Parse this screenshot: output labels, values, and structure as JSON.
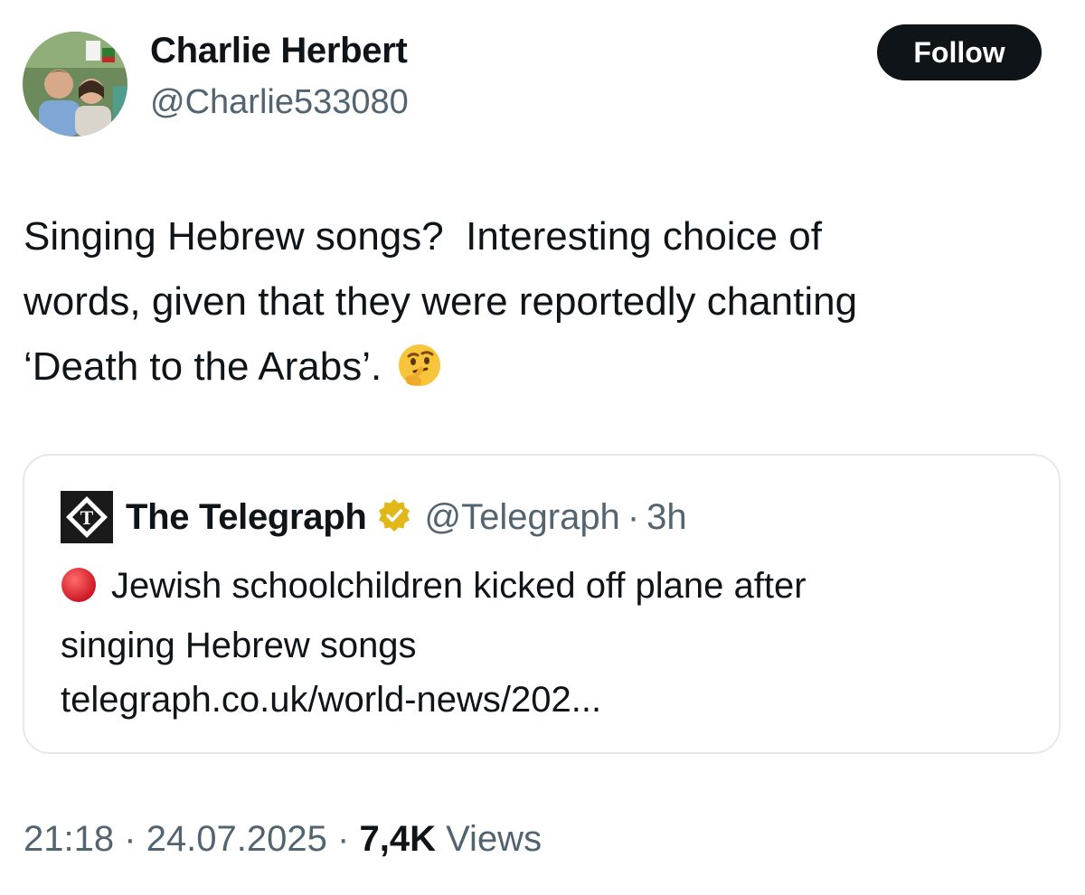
{
  "author": {
    "name": "Charlie Herbert",
    "handle": "@Charlie533080"
  },
  "follow_button": {
    "label": "Follow"
  },
  "tweet": {
    "lines": [
      "Singing Hebrew songs?  Interesting choice of",
      "words, given that they were reportedly chanting",
      "‘Death to the Arabs’."
    ],
    "emoji": "thinking-face-icon"
  },
  "quote": {
    "name": "The Telegraph",
    "handle": "@Telegraph",
    "separator": "·",
    "time": "3h",
    "lines": [
      "Jewish schoolchildren kicked off plane after",
      "singing Hebrew songs",
      "telegraph.co.uk/world-news/202..."
    ],
    "verified_color": "#e2b719"
  },
  "meta": {
    "time": "21:18",
    "sep1": "·",
    "date": "24.07.2025",
    "sep2": "·",
    "views_count": "7,4K",
    "views_label": "Views"
  },
  "colors": {
    "text": "#0f1419",
    "secondary": "#536471",
    "border": "#e6e9ec",
    "follow_bg": "#0f1419"
  }
}
